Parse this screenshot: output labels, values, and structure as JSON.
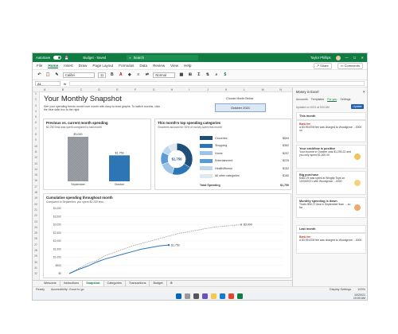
{
  "titlebar": {
    "autosave": "AutoSave",
    "autosave_state": "On",
    "doc_title": "Budget - Saved",
    "search_placeholder": "Search",
    "user": "Taylor Phillips"
  },
  "menu": {
    "items": [
      "File",
      "Home",
      "Insert",
      "Draw",
      "Page Layout",
      "Formulas",
      "Data",
      "Review",
      "View",
      "Help"
    ],
    "active": "Home",
    "share": "Share",
    "comments": "Comments"
  },
  "ribbon": {
    "font": "Calibri",
    "size": "11",
    "style": "Normal"
  },
  "formula_bar": {
    "cell": "A1",
    "fx": "fx"
  },
  "columns": [
    "A",
    "B",
    "C",
    "D",
    "E",
    "F",
    "G",
    "H",
    "I",
    "J",
    "K",
    "L",
    "M",
    "N"
  ],
  "rows": [
    "1",
    "2",
    "3",
    "4",
    "5",
    "6",
    "7",
    "8",
    "9",
    "10",
    "11",
    "12",
    "13",
    "14",
    "15",
    "16",
    "17",
    "18",
    "19",
    "20",
    "21",
    "22",
    "23",
    "24",
    "25",
    "26",
    "27",
    "28",
    "29",
    "30",
    "31",
    "32"
  ],
  "sheet": {
    "title": "Your Monthly Snapshot",
    "subtitle": "See your spending trends month over month with easy-to-read graphs. To switch months, click the blue date box to the right.",
    "choose_label": "Choose Month Below",
    "month": "October 2021"
  },
  "panel_compare": {
    "title": "Previous vs. current month spending",
    "subtitle": "$2,250 less was spent compared to last month",
    "chart_data": {
      "type": "bar",
      "categories": [
        "September",
        "October"
      ],
      "values": [
        3000,
        1750
      ],
      "labels": [
        "$3,000",
        "$1,750"
      ]
    }
  },
  "panel_top": {
    "title": "This month's top spending categories",
    "subtitle": "Groceries account for 34% of money spent this month",
    "center_label": "$1,750",
    "chart_data": {
      "type": "pie",
      "categories": [
        "Groceries",
        "Shopping",
        "Home",
        "Entertainment",
        "Health/fitness",
        "All other categories"
      ],
      "values": [
        594,
        362,
        257,
        225,
        152,
        160
      ],
      "value_labels": [
        "$594",
        "$362",
        "$257",
        "$225",
        "$152",
        "$160"
      ],
      "colors": [
        "#1f4e79",
        "#2e75b6",
        "#9dc3e6",
        "#5b9bd5",
        "#bdd7ee",
        "#dfe7ef"
      ]
    },
    "total_label": "Total Spending",
    "total_value": "$1,750"
  },
  "panel_cumulative": {
    "title": "Cumulative spending throughout month",
    "subtitle": "Compared to September, you spent $2,250 less",
    "chart_data": {
      "type": "line",
      "y_ticks": [
        "$4,000",
        "$3,500",
        "$3,000",
        "$2,500",
        "$2,000",
        "$1,500",
        "$1,000",
        "$500",
        "$0"
      ],
      "ylim": [
        0,
        4000
      ],
      "series": [
        {
          "values": [
            0,
            300,
            600,
            800,
            1100,
            1300,
            1500,
            1700,
            1850,
            2000,
            2150,
            2300,
            2450,
            2550,
            2650,
            2750,
            2850,
            2900,
            2950,
            3000
          ]
        },
        {
          "values": [
            0,
            250,
            450,
            700,
            900,
            1050,
            1200,
            1350,
            1500,
            1600,
            1700,
            1750
          ]
        }
      ],
      "end_labels": [
        "$3,000",
        "$1,750"
      ],
      "colors": [
        "#9a9a9a",
        "#2e75b6"
      ]
    }
  },
  "tabs": [
    "Welcome",
    "Instructions",
    "Snapshot",
    "Categories",
    "Transactions",
    "Budget"
  ],
  "active_tab": "Snapshot",
  "status": {
    "ready": "Ready",
    "accessibility": "Accessibility: Good to go",
    "display": "Display Settings",
    "zoom": "100%"
  },
  "taskbar": {
    "time": "10:00 AM",
    "date": "10/20/21"
  },
  "side": {
    "title": "Money in Excel",
    "tabs": [
      "Accounts",
      "Templates",
      "For you",
      "Settings"
    ],
    "active_tab": "For you",
    "updated": "Updated on 10/21 at 9:00 AM",
    "update_button": "Update",
    "section_month": "This month",
    "card1": {
      "head": "Bank fee",
      "body": "A $3.99 ATM fee was charged to Woodgrove ...0000 on"
    },
    "card2": {
      "head": "Your cashflow is positive",
      "body": "Your income in October was $1,250.22 and you only spent $1,000.00"
    },
    "card3": {
      "head": "Big purchase",
      "body": "$482.29 was spent at Wingtip Toys on 10/03/2021 with Woodgrove ...0000"
    },
    "card4": {
      "head": "Monthly spending is down",
      "body": "That's $90.27 less in September than ... so far"
    },
    "section_last": "Last month",
    "card5": {
      "head": "Bank fee",
      "body": "A $3.99 ATM fee was charged to Woodgrove ...0000"
    }
  }
}
